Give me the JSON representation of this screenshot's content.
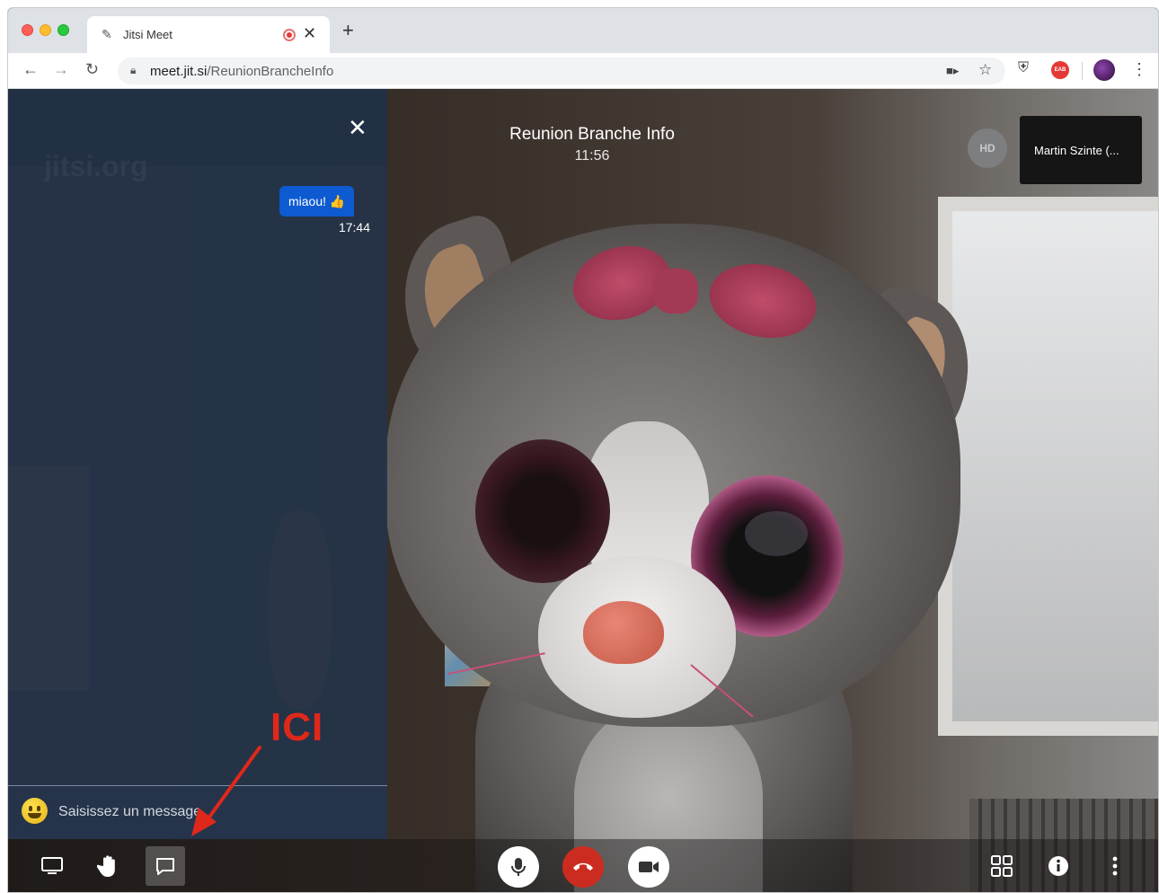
{
  "browser": {
    "tab_title": "Jitsi Meet",
    "url_host": "meet.jit.si",
    "url_path": "/ReunionBrancheInfo",
    "new_tab_label": "+",
    "extension_badge": "EAB"
  },
  "meeting": {
    "title": "Reunion Branche Info",
    "time": "11:56",
    "quality_badge": "HD",
    "participant_name": "Martin Szinte (..."
  },
  "chat": {
    "watermark": "jitsi.org",
    "message_text": "miaou! 👍",
    "message_time": "17:44",
    "input_placeholder": "Saisissez un message"
  },
  "annotation": {
    "label": "ICI",
    "color": "#e0281a"
  },
  "colors": {
    "chat_panel": "#25344a",
    "message_bubble": "#0e5bd1",
    "hangup": "#cc2c1f"
  },
  "icons": {
    "share_screen": "monitor-icon",
    "raise_hand": "hand-icon",
    "chat": "chat-bubble-icon",
    "microphone": "microphone-icon",
    "hangup": "phone-icon",
    "camera": "video-camera-icon",
    "tile_view": "grid-icon",
    "info": "info-icon",
    "more": "more-vertical-icon"
  }
}
